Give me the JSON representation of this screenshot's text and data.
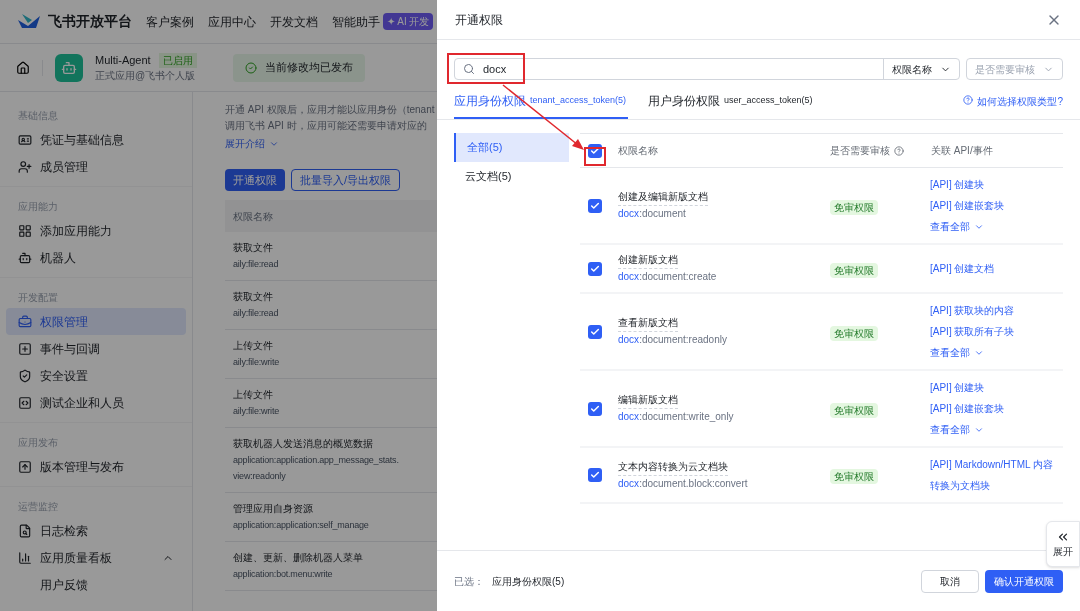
{
  "nav": {
    "brand": "飞书开放平台",
    "links": [
      "客户案例",
      "应用中心",
      "开发文档",
      "智能助手"
    ],
    "badge": "✦ AI 开发"
  },
  "app_header": {
    "name": "Multi-Agent",
    "status": "已启用",
    "subtitle": "正式应用@飞书个人版",
    "notice": "当前修改均已发布"
  },
  "sidebar": {
    "sections": [
      {
        "title": "基础信息",
        "items": [
          {
            "label": "凭证与基础信息",
            "selected": false
          },
          {
            "label": "成员管理",
            "selected": false
          }
        ]
      },
      {
        "title": "应用能力",
        "items": [
          {
            "label": "添加应用能力",
            "selected": false
          },
          {
            "label": "机器人",
            "selected": false
          }
        ]
      },
      {
        "title": "开发配置",
        "items": [
          {
            "label": "权限管理",
            "selected": true
          },
          {
            "label": "事件与回调",
            "selected": false
          },
          {
            "label": "安全设置",
            "selected": false
          },
          {
            "label": "测试企业和人员",
            "selected": false
          }
        ]
      },
      {
        "title": "应用发布",
        "items": [
          {
            "label": "版本管理与发布",
            "selected": false
          }
        ]
      },
      {
        "title": "运营监控",
        "items": [
          {
            "label": "日志检索",
            "selected": false
          },
          {
            "label": "应用质量看板",
            "selected": false,
            "expanded": true,
            "children": [
              {
                "label": "用户反馈",
                "selected": false
              }
            ]
          }
        ]
      }
    ]
  },
  "content": {
    "intro": [
      "开通 API 权限后，应用才能以应用身份（tenant",
      "调用飞书 API 时，应用可能还需要申请对应的"
    ],
    "expand_link": "展开介绍",
    "buttons": [
      "开通权限",
      "批量导入/导出权限"
    ],
    "column": "权限名称",
    "rows": [
      {
        "name": "获取文件",
        "scope": [
          "aily:file:read"
        ]
      },
      {
        "name": "获取文件",
        "scope": [
          "aily:file:read"
        ]
      },
      {
        "name": "上传文件",
        "scope": [
          "aily:file:write"
        ]
      },
      {
        "name": "上传文件",
        "scope": [
          "aily:file:write"
        ]
      },
      {
        "name": "获取机器人发送消息的概览数据",
        "scope": [
          "application:application.app_message_stats.",
          "view:readonly"
        ]
      },
      {
        "name": "管理应用自身资源",
        "scope": [
          "application:application:self_manage"
        ]
      },
      {
        "name": "创建、更新、删除机器人菜单",
        "scope": [
          "application:bot.menu:write"
        ]
      }
    ]
  },
  "drawer": {
    "title": "开通权限",
    "search": {
      "value": "docx"
    },
    "filters": [
      {
        "label": "权限名称",
        "kind": "value"
      },
      {
        "label": "是否需要审核",
        "kind": "placeholder"
      }
    ],
    "tabs": [
      {
        "label": "应用身份权限",
        "token": "tenant_access_token(5)",
        "selected": true
      },
      {
        "label": "用户身份权限",
        "token": "user_access_token(5)",
        "selected": false
      }
    ],
    "help_link": "如何选择权限类型?",
    "categories": [
      {
        "label": "全部(5)",
        "selected": true
      },
      {
        "label": "云文档(5)",
        "selected": false
      }
    ],
    "table": {
      "all_checked": true,
      "columns": [
        "权限名称",
        "是否需要审核",
        "关联 API/事件"
      ],
      "rows": [
        {
          "checked": true,
          "name": "创建及编辑新版文档",
          "scope_match": "docx",
          "scope_rest": ":document",
          "badge": "免审权限",
          "apis": [
            "[API] 创建块",
            "[API] 创建嵌套块"
          ],
          "more": "查看全部"
        },
        {
          "checked": true,
          "name": "创建新版文档",
          "scope_match": "docx",
          "scope_rest": ":document:create",
          "badge": "免审权限",
          "apis": [
            "[API] 创建文档"
          ]
        },
        {
          "checked": true,
          "name": "查看新版文档",
          "scope_match": "docx",
          "scope_rest": ":document:readonly",
          "badge": "免审权限",
          "apis": [
            "[API] 获取块的内容",
            "[API] 获取所有子块"
          ],
          "more": "查看全部"
        },
        {
          "checked": true,
          "name": "编辑新版文档",
          "scope_match": "docx",
          "scope_rest": ":document:write_only",
          "badge": "免审权限",
          "apis": [
            "[API] 创建块",
            "[API] 创建嵌套块"
          ],
          "more": "查看全部"
        },
        {
          "checked": true,
          "name": "文本内容转换为云文档块",
          "scope_match": "docx",
          "scope_rest": ":document.block:convert",
          "badge": "免审权限",
          "apis": [
            "[API] Markdown/HTML 内容转换为文档块"
          ]
        }
      ]
    },
    "footer": {
      "label": "已选：",
      "value": "应用身份权限(5)",
      "cancel": "取消",
      "confirm": "确认开通权限"
    },
    "side_toggle": "展开"
  }
}
